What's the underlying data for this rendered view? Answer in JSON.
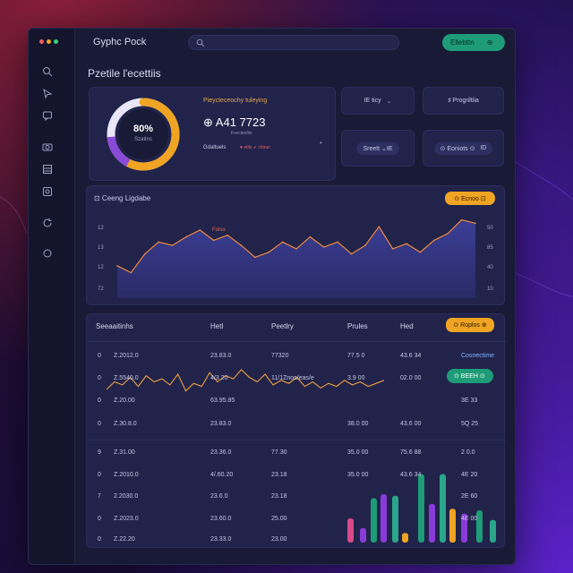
{
  "colors": {
    "accent_orange": "#f0a423",
    "accent_green": "#1e9c78",
    "panel": "#21234a",
    "window": "#191a36"
  },
  "window": {
    "dots": [
      "#f45b69",
      "#f0a423",
      "#36d17c"
    ]
  },
  "sidebar": {
    "icons": [
      "search-icon",
      "cursor-icon",
      "chat-icon",
      "camera-icon",
      "grid-icon",
      "image-icon",
      "refresh-icon",
      "circle-icon"
    ]
  },
  "topbar": {
    "app_title": "Gyphc Pock",
    "search_placeholder": "",
    "button_label": "Ellebttn",
    "button_suffix": "⊕"
  },
  "panel": {
    "title": "Pzetile l'ecettiis"
  },
  "summary": {
    "ring_value": "80%",
    "ring_sub": "Szatins",
    "ring_pct": 80,
    "line1": "Pieycteceochy tuleying",
    "big_value": "⊕ A41 7723",
    "sub": "Fvecteslits",
    "legend": "Gdaltuels",
    "legend_b": "♥ etlts ✔ clttnei",
    "legend_c": "•"
  },
  "mini_buttons": [
    {
      "label": "IE  ticy",
      "suffix": "⌄"
    },
    {
      "label": "♯  Progriltiia",
      "suffix": ""
    },
    {
      "label": "Sreett ⌄IE",
      "suffix": ""
    },
    {
      "label": "⊙ Eoniots ⊙",
      "suffix": "ID"
    }
  ],
  "chart": {
    "title": "⊡ Ceeng Ligdabe",
    "pill": "⊙ Ecnoo ⊡",
    "peak_label": "Foiso",
    "y_ticks_left": [
      "12",
      "13",
      "12",
      "72"
    ],
    "y_ticks_right": [
      "50",
      "85",
      "40",
      "10"
    ]
  },
  "chart_data": {
    "type": "area",
    "series": [
      {
        "name": "",
        "values": [
          38,
          30,
          52,
          66,
          62,
          72,
          80,
          68,
          74,
          62,
          48,
          54,
          66,
          58,
          72,
          60,
          66,
          52,
          62,
          84,
          58,
          64,
          54,
          68,
          76,
          92,
          88
        ]
      }
    ],
    "ylim": [
      0,
      100
    ]
  },
  "table": {
    "headers": [
      "Seeaaitinhs",
      "Hetl",
      "Peetlry",
      "Prules",
      "Hed"
    ],
    "pill": "⊙ Roplos ⊕",
    "rows": [
      {
        "n": "0",
        "a": "Z.2012.0",
        "b": "23.83.0",
        "c": "77320",
        "d": "77.5 0",
        "e": "43.6 34",
        "f": "Cosnectime"
      },
      {
        "n": "0",
        "a": "Z.5540.0",
        "b": "4/3 20",
        "c": "11/1Znos/eas/e",
        "d": "3.9 00",
        "e": "02.0 00",
        "f": "⊙ BEEH ⊙"
      },
      {
        "n": "0",
        "a": "Z.20.00",
        "b": "63.95.85",
        "c": "",
        "d": "",
        "e": "",
        "f": "3E 33"
      },
      {
        "n": "0",
        "a": "Z.30.8.0",
        "b": "23.83.0",
        "c": "",
        "d": "38.0 00",
        "e": "43.6 00",
        "f": "5Q 25"
      },
      {
        "n": "9",
        "a": "Z.31.00",
        "b": "23.36.0",
        "c": "77.30",
        "d": "35.0 00",
        "e": "75.6 88",
        "f": "2 0.0"
      },
      {
        "n": "0",
        "a": "Z.2010.0",
        "b": "4/.60.20",
        "c": "23.18",
        "d": "35.0 00",
        "e": "43.6 34",
        "f": "4E 20"
      },
      {
        "n": "7",
        "a": "2.2030.0",
        "b": "23.6.0",
        "c": "23.18",
        "d": "",
        "e": "",
        "f": "2E 60"
      },
      {
        "n": "0",
        "a": "Z.2023.0",
        "b": "23.60.0",
        "c": "25.00",
        "d": "",
        "e": "",
        "f": "4E 00"
      },
      {
        "n": "0",
        "a": "Z.22.20",
        "b": "23.33.0",
        "c": "23.00",
        "d": "",
        "e": "",
        "f": ""
      }
    ]
  },
  "mini_line_data": {
    "type": "line",
    "values": [
      40,
      50,
      46,
      56,
      44,
      58,
      50,
      54,
      46,
      60,
      38,
      48,
      44,
      62,
      50,
      58,
      54,
      66,
      56,
      50,
      60,
      46,
      52,
      48,
      56,
      44,
      50,
      42,
      48,
      44,
      52,
      46,
      50,
      44,
      48,
      52
    ]
  },
  "bar_data": {
    "type": "bar",
    "values": [
      30,
      18,
      55,
      60,
      58,
      12,
      85,
      48,
      85,
      42,
      36,
      40,
      28,
      20
    ]
  }
}
